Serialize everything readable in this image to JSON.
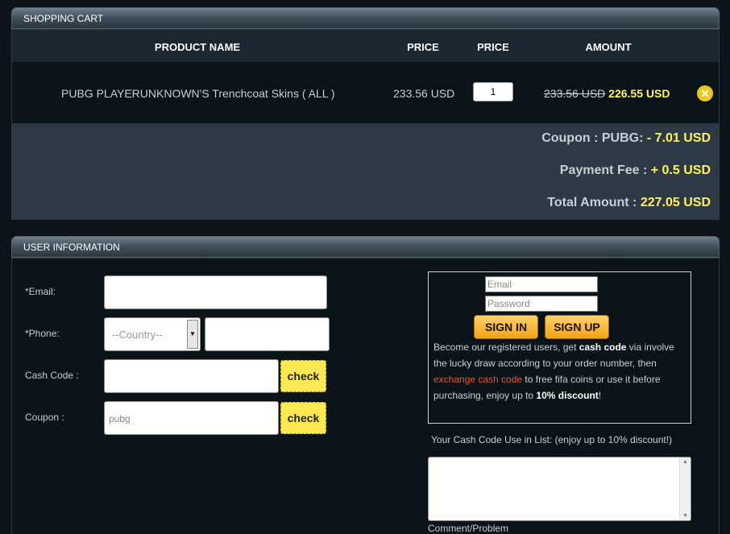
{
  "cart": {
    "title": "SHOPPING CART",
    "headers": {
      "product": "PRODUCT NAME",
      "price": "PRICE",
      "price2": "PRICE",
      "amount": "AMOUNT"
    },
    "item": {
      "name": "PUBG PLAYERUNKNOWN'S Trenchcoat Skins ( ALL )",
      "price": "233.56 USD",
      "quantity": "1",
      "old_amount": "233.56 USD",
      "new_amount": "226.55 USD",
      "remove_icon": "close-icon"
    },
    "summary": {
      "coupon_label": "Coupon : PUBG:",
      "coupon_value": "- 7.01 USD",
      "fee_label": "Payment Fee :",
      "fee_value": "+ 0.5 USD",
      "total_label": "Total Amount :",
      "total_value": "227.05 USD"
    }
  },
  "user": {
    "title": "USER INFORMATION",
    "email_label": "*Email:",
    "phone_label": "*Phone:",
    "country_placeholder": "--Country--",
    "cashcode_label": "Cash Code :",
    "coupon_label": "Coupon :",
    "coupon_value": "pubg",
    "check_label": "check",
    "login": {
      "email_placeholder": "Email",
      "password_placeholder": "Password",
      "signin": "SIGN IN",
      "signup": "SIGN UP",
      "promo": {
        "t1": "Become our registered users, get ",
        "b1": "cash code",
        "t2": " via involve the lucky draw according to your order number, then ",
        "link": "exchange cash code",
        "t3": " to free fifa coins or use it before purchasing, enjoy up to ",
        "b2": "10% discount",
        "t4": "!"
      }
    },
    "cash_code_list_label": "Your Cash Code Use in List: (enjoy up to 10% discount!)",
    "comment_label": "Comment/Problem"
  },
  "colors": {
    "accent_yellow": "#fff35c",
    "button_orange": "#f5a216",
    "check_yellow": "#ffe853",
    "link_red": "#f2552c"
  }
}
